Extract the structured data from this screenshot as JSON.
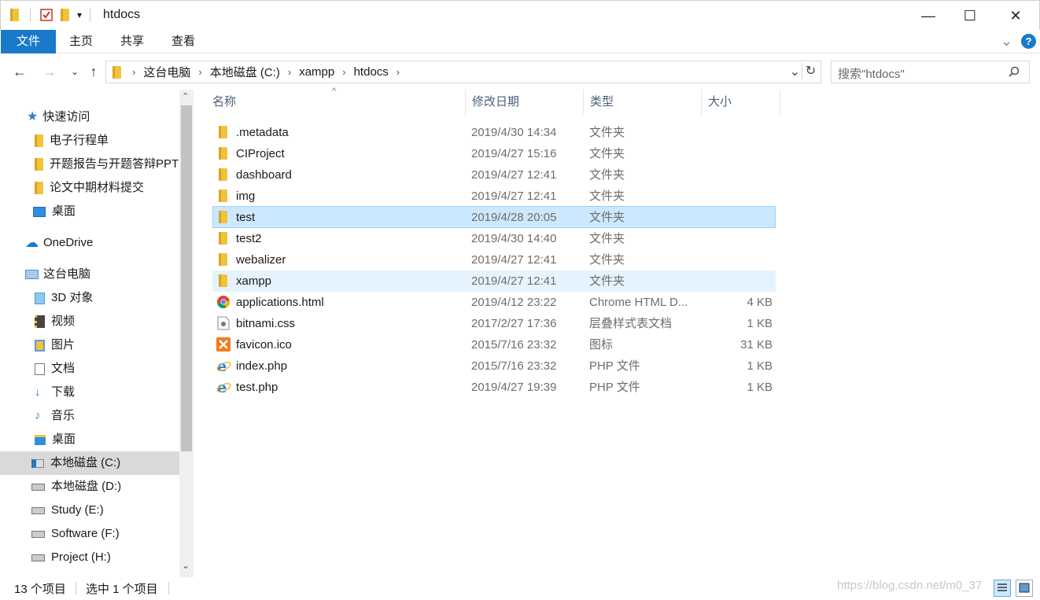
{
  "window": {
    "title": "htdocs",
    "quick_access_arrow": "▾",
    "minimize": "—",
    "maximize": "☐",
    "close": "✕"
  },
  "ribbon": {
    "tabs": [
      "文件",
      "主页",
      "共享",
      "查看"
    ],
    "collapse": "⌄",
    "help": "?"
  },
  "address": {
    "crumbs": [
      "这台电脑",
      "本地磁盘 (C:)",
      "xampp",
      "htdocs"
    ],
    "search_placeholder": "搜索\"htdocs\""
  },
  "nav": {
    "quick_access": "快速访问",
    "qa_items": [
      "电子行程单",
      "开题报告与开题答辩PPT",
      "论文中期材料提交",
      "桌面"
    ],
    "onedrive": "OneDrive",
    "this_pc": "这台电脑",
    "pc_items": [
      "3D 对象",
      "视频",
      "图片",
      "文档",
      "下载",
      "音乐",
      "桌面"
    ],
    "drives": [
      "本地磁盘 (C:)",
      "本地磁盘 (D:)",
      "Study (E:)",
      "Software (F:)",
      "Project (H:)"
    ]
  },
  "columns": [
    "名称",
    "修改日期",
    "类型",
    "大小"
  ],
  "files": [
    {
      "name": ".metadata",
      "date": "2019/4/30 14:34",
      "type": "文件夹",
      "size": "",
      "icon": "folder-icon"
    },
    {
      "name": "CIProject",
      "date": "2019/4/27 15:16",
      "type": "文件夹",
      "size": "",
      "icon": "folder-icon"
    },
    {
      "name": "dashboard",
      "date": "2019/4/27 12:41",
      "type": "文件夹",
      "size": "",
      "icon": "folder-icon"
    },
    {
      "name": "img",
      "date": "2019/4/27 12:41",
      "type": "文件夹",
      "size": "",
      "icon": "folder-icon"
    },
    {
      "name": "test",
      "date": "2019/4/28 20:05",
      "type": "文件夹",
      "size": "",
      "icon": "folder-icon"
    },
    {
      "name": "test2",
      "date": "2019/4/30 14:40",
      "type": "文件夹",
      "size": "",
      "icon": "folder-icon"
    },
    {
      "name": "webalizer",
      "date": "2019/4/27 12:41",
      "type": "文件夹",
      "size": "",
      "icon": "folder-icon"
    },
    {
      "name": "xampp",
      "date": "2019/4/27 12:41",
      "type": "文件夹",
      "size": "",
      "icon": "folder-icon"
    },
    {
      "name": "applications.html",
      "date": "2019/4/12 23:22",
      "type": "Chrome HTML D...",
      "size": "4 KB",
      "icon": "chrome-icon"
    },
    {
      "name": "bitnami.css",
      "date": "2017/2/27 17:36",
      "type": "层叠样式表文档",
      "size": "1 KB",
      "icon": "css-file-icon"
    },
    {
      "name": "favicon.ico",
      "date": "2015/7/16 23:32",
      "type": "图标",
      "size": "31 KB",
      "icon": "xampp-icon"
    },
    {
      "name": "index.php",
      "date": "2015/7/16 23:32",
      "type": "PHP 文件",
      "size": "1 KB",
      "icon": "ie-icon"
    },
    {
      "name": "test.php",
      "date": "2019/4/27 19:39",
      "type": "PHP 文件",
      "size": "1 KB",
      "icon": "ie-icon"
    }
  ],
  "status": {
    "count": "13 个项目",
    "selected": "选中 1 个项目"
  },
  "watermark": "https://blog.csdn.net/m0_37"
}
